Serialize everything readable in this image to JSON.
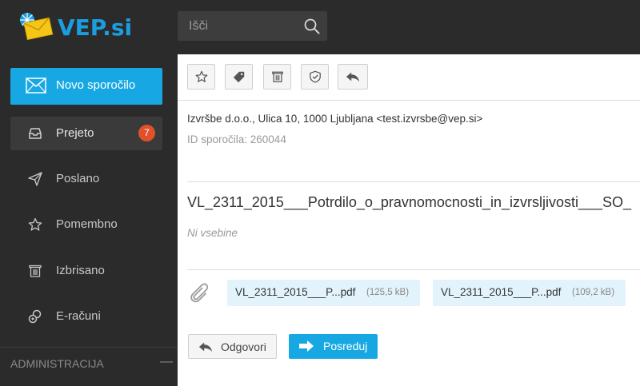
{
  "brand": {
    "name": "VEP.si",
    "accent": "#17a8e3"
  },
  "search": {
    "placeholder": "Išči"
  },
  "sidebar": {
    "compose_label": "Novo sporočilo",
    "items": [
      {
        "label": "Prejeto",
        "badge": "7",
        "active": true,
        "icon": "inbox-icon"
      },
      {
        "label": "Poslano",
        "icon": "paper-plane-icon"
      },
      {
        "label": "Pomembno",
        "icon": "star-icon"
      },
      {
        "label": "Izbrisano",
        "icon": "trash-icon"
      },
      {
        "label": "E-računi",
        "icon": "coins-icon"
      }
    ],
    "admin_label": "ADMINISTRACIJA",
    "admin_toggle": "—"
  },
  "toolbar": [
    "star-icon",
    "tag-icon",
    "trash-icon",
    "shield-icon",
    "reply-icon"
  ],
  "message": {
    "sender": "Izvršbe d.o.o., Ulica 10, 1000 Ljubljana <test.izvrsbe@vep.si>",
    "message_id": "ID sporočila: 260044",
    "subject": "VL_2311_2015___Potrdilo_o_pravnomocnosti_in_izvrsljivosti___SO_",
    "body": "Ni vsebine",
    "attachments": [
      {
        "name": "VL_2311_2015___P...pdf",
        "size": "(125,5 kB)"
      },
      {
        "name": "VL_2311_2015___P...pdf",
        "size": "(109,2 kB)"
      }
    ]
  },
  "actions": {
    "reply_label": "Odgovori",
    "forward_label": "Posreduj"
  }
}
